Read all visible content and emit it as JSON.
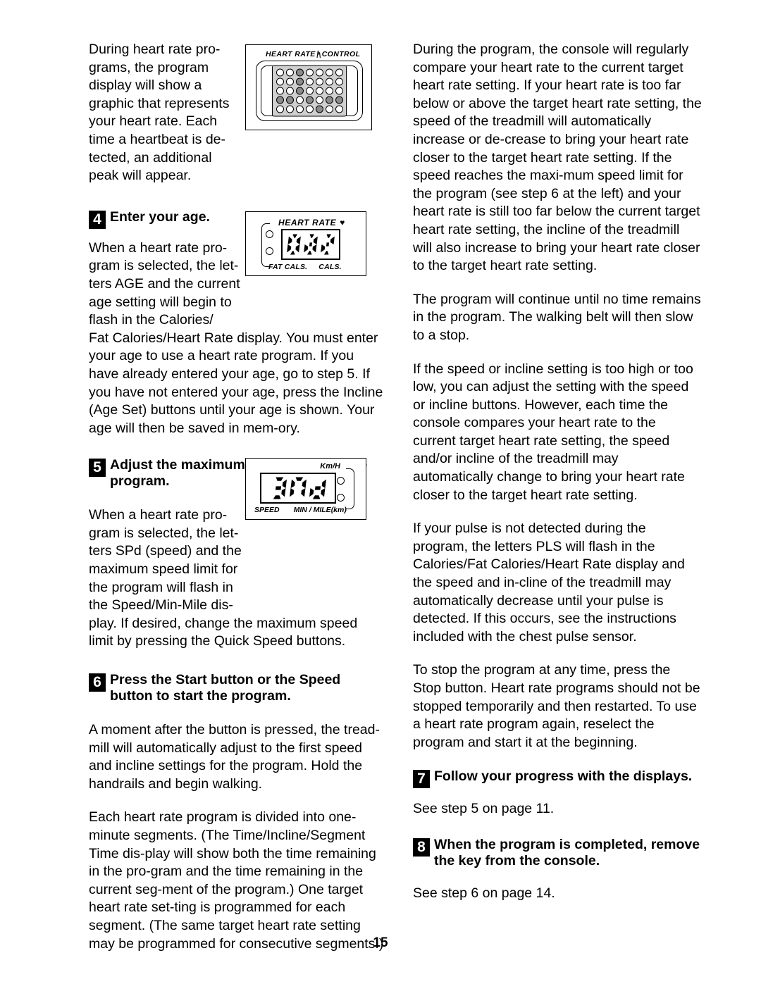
{
  "page": {
    "number": "15"
  },
  "left_column": {
    "intro_paragraph": "During heart rate pro-grams, the program display will show a graphic that represents your heart rate. Each time a heartbeat is de-tected, an additional peak will appear.",
    "steps": [
      {
        "number": "4",
        "title": "Enter your age.",
        "body_narrow": "When a heart rate pro-gram is selected, the let-ters AGE and the current age setting will begin to flash in the Calories/",
        "body_wide": "Fat Calories/Heart Rate display. You must enter your age to use a heart rate program. If you have already entered your age, go to step 5. If you have not entered your age, press the Incline (Age Set) buttons until your age is shown. Your age will then be saved in mem-ory."
      },
      {
        "number": "5",
        "title": "Adjust the maximum speed limit for the program.",
        "body_narrow": "When a heart rate pro-gram is selected, the let-ters SPd (speed) and the maximum speed limit for the program will flash in the Speed/Min-Mile dis-",
        "body_wide": "play. If desired, change the maximum speed limit by pressing the Quick Speed buttons."
      },
      {
        "number": "6",
        "title_part1": "Press the Start button or the Speed",
        "title_part2": "button to start the program.",
        "body_1": "A moment after the button is pressed, the tread-mill will automatically adjust to the first speed and incline settings for the program. Hold the handrails and begin walking.",
        "body_2": "Each heart rate program is divided into one-minute segments. (The Time/Incline/Segment Time dis-play will show both the time remaining in the pro-gram and the time remaining in the current seg-ment of the program.) One target heart rate set-ting is programmed for each segment. (The same target heart rate setting may be programmed for consecutive segments.)"
      }
    ]
  },
  "right_column": {
    "paragraphs": [
      "During the program, the console will regularly compare your heart rate to the current target heart rate setting. If your heart rate is too far below or above the target heart rate setting, the speed of the treadmill will automatically increase or de-crease to bring your heart rate closer to the target heart rate setting. If the speed reaches the maxi-mum speed limit for the program (see step 6 at the left) and your heart rate is still too far below the current target heart rate setting, the incline of the treadmill will also increase to bring your heart rate closer to the target heart rate setting.",
      "The program will continue until no time remains in the program. The walking belt will then slow to a stop.",
      "If the speed or incline setting is too high or too low, you can adjust the setting with the speed or incline buttons. However, each time the console compares your heart rate to the current target heart rate setting, the speed and/or incline of the treadmill may automatically change to bring your heart rate closer to the target heart rate setting.",
      "If your pulse is not detected during the program, the letters PLS will flash in the Calories/Fat Calories/Heart Rate display and the speed and in-cline of the treadmill may automatically decrease until your pulse is detected. If this occurs, see the instructions included with the chest pulse sensor.",
      "To stop the program at any time, press the Stop button. Heart rate programs should not be stopped temporarily and then restarted. To use a heart rate program again, reselect the program and start it at the beginning."
    ],
    "steps": [
      {
        "number": "7",
        "title": "Follow your progress with the displays.",
        "body": "See step 5 on page 11."
      },
      {
        "number": "8",
        "title": "When the program is completed, remove the key from the console.",
        "body": "See step 6 on page 14."
      }
    ]
  },
  "figures": {
    "heart_rate_control": {
      "label_part1": "HEART RATE",
      "label_part2": "CONTROL",
      "columns": 7,
      "rows": 5,
      "matrix": [
        [
          0,
          0,
          1,
          0,
          0,
          0,
          0
        ],
        [
          0,
          0,
          1,
          0,
          0,
          0,
          0
        ],
        [
          0,
          0,
          1,
          0,
          0,
          0,
          0
        ],
        [
          1,
          1,
          0,
          1,
          0,
          1,
          1
        ],
        [
          0,
          0,
          0,
          0,
          1,
          0,
          0
        ]
      ]
    },
    "age_display": {
      "top_label": "HEART RATE",
      "heart_glyph": "♥",
      "value": "AGE",
      "bottom_label_left": "FAT CALS.",
      "bottom_label_right": "CALS.",
      "indicator_count": 2
    },
    "speed_display": {
      "top_label": "Km/H",
      "value": "SPd",
      "bottom_label_left": "SPEED",
      "bottom_label_right": "MIN / MILE(km)",
      "indicator_count": 2
    }
  }
}
